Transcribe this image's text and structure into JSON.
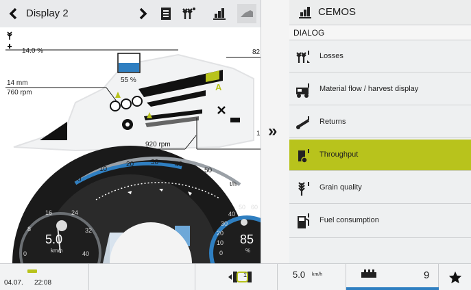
{
  "topbar": {
    "title": "Display 2",
    "icons": [
      "chevron-left-icon",
      "chevron-right-icon",
      "document-icon",
      "grain-icon",
      "cemos-icon",
      "combine-icon"
    ]
  },
  "machine": {
    "percent_top": "14.0 %",
    "right_value": "82",
    "tank_percent": "55 %",
    "mm_value": "14 mm",
    "rpm_left": "760 rpm",
    "rpm_bottom": "920 rpm",
    "label_a": "A",
    "edge_value": "1"
  },
  "gauge": {
    "ticks": [
      "0",
      "10",
      "20",
      "30",
      "40",
      "50",
      "t/h"
    ],
    "speed_ticks": [
      "8",
      "16",
      "24",
      "32",
      "40",
      "0"
    ],
    "speed_value": "5.0",
    "speed_unit": "km/h",
    "fuel_ticks": [
      "50",
      "60",
      "40",
      "30",
      "20",
      "10",
      "0"
    ],
    "fuel_value": "85",
    "fuel_unit": "%"
  },
  "panel": {
    "title": "CEMOS",
    "dialog_label": "DIALOG",
    "items": [
      {
        "label": "Losses",
        "icon": "losses-icon"
      },
      {
        "label": "Material flow / harvest display",
        "icon": "material-flow-icon"
      },
      {
        "label": "Returns",
        "icon": "returns-icon"
      },
      {
        "label": "Throughput",
        "icon": "throughput-icon"
      },
      {
        "label": "Grain quality",
        "icon": "grain-quality-icon"
      },
      {
        "label": "Fuel consumption",
        "icon": "fuel-icon"
      }
    ],
    "active_index": 3,
    "colors": {
      "active": "#b8c31c",
      "accent_blue": "#2f7fc1"
    }
  },
  "strip": {
    "expand_glyph": "»"
  },
  "bottom": {
    "date": "04.07.",
    "time": "22:08",
    "speed": "5.0",
    "speed_unit": "km/h",
    "gear": "1",
    "header_count": "9"
  }
}
